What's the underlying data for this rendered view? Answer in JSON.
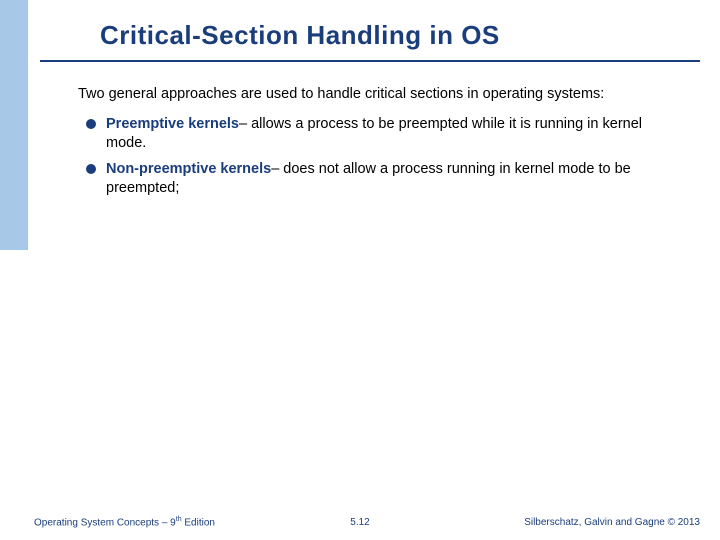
{
  "title": "Critical-Section Handling in OS",
  "intro": "Two general approaches are used to handle critical sections in operating systems:",
  "bullets": [
    {
      "term": "Preemptive kernels",
      "desc": "– allows a process to be preempted while it is running in kernel mode."
    },
    {
      "term": "Non-preemptive kernels",
      "desc": "– does not allow a process running in kernel mode to be preempted;"
    }
  ],
  "footer": {
    "left_pre": "Operating System Concepts – 9",
    "left_sup": "th",
    "left_post": " Edition",
    "center": "5.12",
    "right": "Silberschatz, Galvin and Gagne © 2013"
  }
}
